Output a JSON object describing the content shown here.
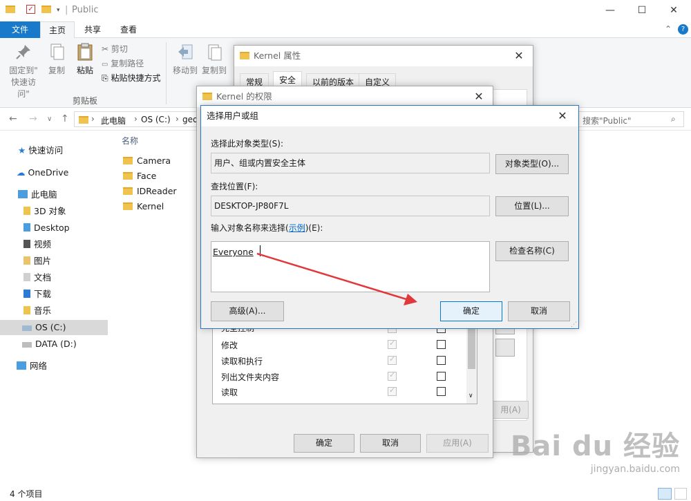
{
  "window": {
    "title": "Public",
    "controls": {
      "minimize": "—",
      "maximize": "☐",
      "close": "✕"
    }
  },
  "ribbon": {
    "tabs": [
      {
        "label": "文件"
      },
      {
        "label": "主页"
      },
      {
        "label": "共享"
      },
      {
        "label": "查看"
      }
    ],
    "pin_label_1": "固定到\"",
    "pin_label_2": "快速访问\"",
    "copy": "复制",
    "paste": "粘贴",
    "cut": "剪切",
    "copy_path": "复制路径",
    "paste_shortcut": "粘贴快捷方式",
    "move_to": "移动到",
    "copy_to": "复制到",
    "group_clipboard": "剪贴板"
  },
  "address": {
    "crumbs": [
      "此电脑",
      "OS (C:)",
      "geo"
    ],
    "search_placeholder": "搜索\"Public\""
  },
  "nav": {
    "items": [
      {
        "label": "快速访问",
        "icon": "star-icon"
      },
      {
        "label": "OneDrive",
        "icon": "cloud-icon"
      },
      {
        "label": "此电脑",
        "icon": "computer-icon"
      },
      {
        "label": "3D 对象",
        "icon": "cube-icon"
      },
      {
        "label": "Desktop",
        "icon": "desktop-icon"
      },
      {
        "label": "视频",
        "icon": "video-icon"
      },
      {
        "label": "图片",
        "icon": "picture-icon"
      },
      {
        "label": "文档",
        "icon": "document-icon"
      },
      {
        "label": "下载",
        "icon": "download-icon"
      },
      {
        "label": "音乐",
        "icon": "music-icon"
      },
      {
        "label": "OS (C:)",
        "icon": "drive-icon"
      },
      {
        "label": "DATA (D:)",
        "icon": "drive-icon"
      },
      {
        "label": "网络",
        "icon": "network-icon"
      }
    ]
  },
  "files": {
    "column_header": "名称",
    "items": [
      "Camera",
      "Face",
      "IDReader",
      "Kernel"
    ]
  },
  "status": {
    "count": "4 个项目"
  },
  "props_dialog": {
    "title": "Kernel 属性",
    "tabs": [
      "常规",
      "安全",
      "以前的版本",
      "自定义"
    ],
    "apply_partial": "用(A)"
  },
  "perm_dialog": {
    "title": "Kernel 的权限",
    "rows": [
      "完全控制",
      "修改",
      "读取和执行",
      "列出文件夹内容",
      "读取"
    ],
    "ok": "确定",
    "cancel": "取消",
    "apply": "应用(A)"
  },
  "select_dialog": {
    "title": "选择用户或组",
    "object_type_label": "选择此对象类型(S):",
    "object_type_value": "用户、组或内置安全主体",
    "object_type_button": "对象类型(O)...",
    "location_label": "查找位置(F):",
    "location_value": "DESKTOP-JP80F7L",
    "location_button": "位置(L)...",
    "enter_label_pre": "输入对象名称来选择(",
    "enter_label_link": "示例",
    "enter_label_post": ")(E):",
    "entry_value": "Everyone",
    "check_names_button": "检查名称(C)",
    "advanced_button": "高级(A)...",
    "ok": "确定",
    "cancel": "取消"
  },
  "watermark": {
    "logo": "Bai du 经验",
    "url": "jingyan.baidu.com"
  },
  "colors": {
    "accent": "#1979ca",
    "arrow": "#e0383b"
  }
}
